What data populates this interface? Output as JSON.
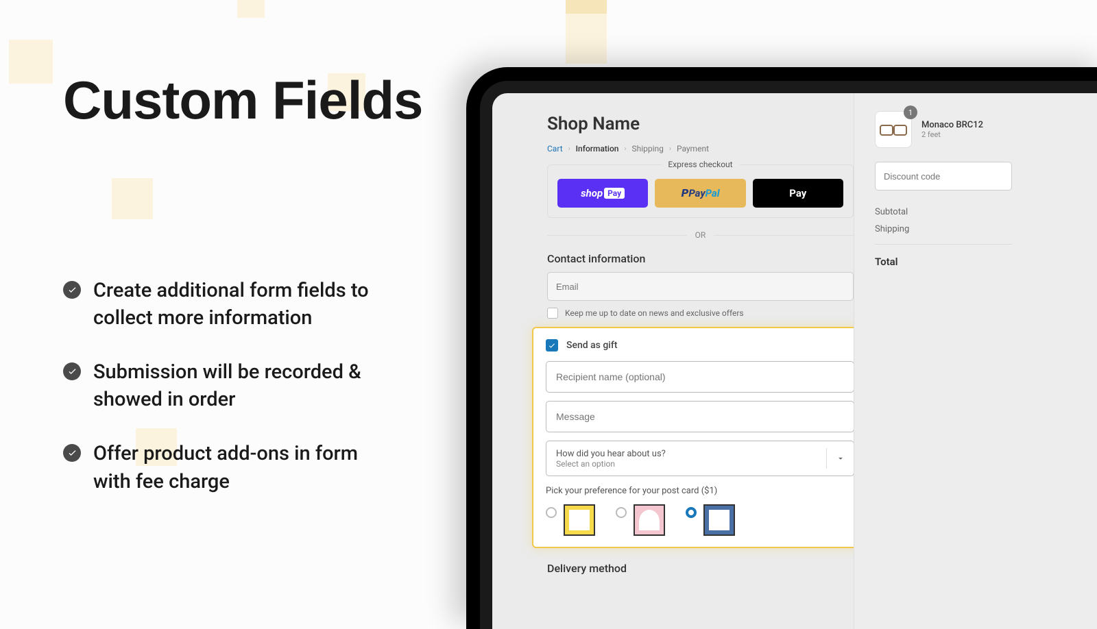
{
  "hero": {
    "title": "Custom Fields",
    "bullets": [
      "Create additional form fields to collect more information",
      "Submission will be recorded & showed in order",
      "Offer product add-ons in form with fee charge"
    ]
  },
  "checkout": {
    "shop_name": "Shop Name",
    "breadcrumb": {
      "cart": "Cart",
      "information": "Information",
      "shipping": "Shipping",
      "payment": "Payment"
    },
    "express_label": "Express checkout",
    "pay": {
      "shop_prefix": "shop",
      "shop_suffix": "Pay",
      "paypal_p": "Pay",
      "paypal_pal": "Pal",
      "apple": " Pay"
    },
    "or": "OR",
    "contact_heading": "Contact information",
    "email_placeholder": "Email",
    "news_opt": "Keep me up to date on news and exclusive offers",
    "gift": {
      "send_as_gift": "Send as gift",
      "recipient_placeholder": "Recipient name (optional)",
      "message_placeholder": "Message",
      "hear_question": "How did you hear about us?",
      "hear_placeholder": "Select an option",
      "pref_label": "Pick your preference for your post card ($1)"
    },
    "delivery_heading": "Delivery method"
  },
  "sidebar": {
    "item": {
      "name": "Monaco BRC12",
      "variant": "2 feet",
      "qty": "1"
    },
    "discount_placeholder": "Discount code",
    "subtotal_label": "Subtotal",
    "shipping_label": "Shipping",
    "total_label": "Total"
  }
}
